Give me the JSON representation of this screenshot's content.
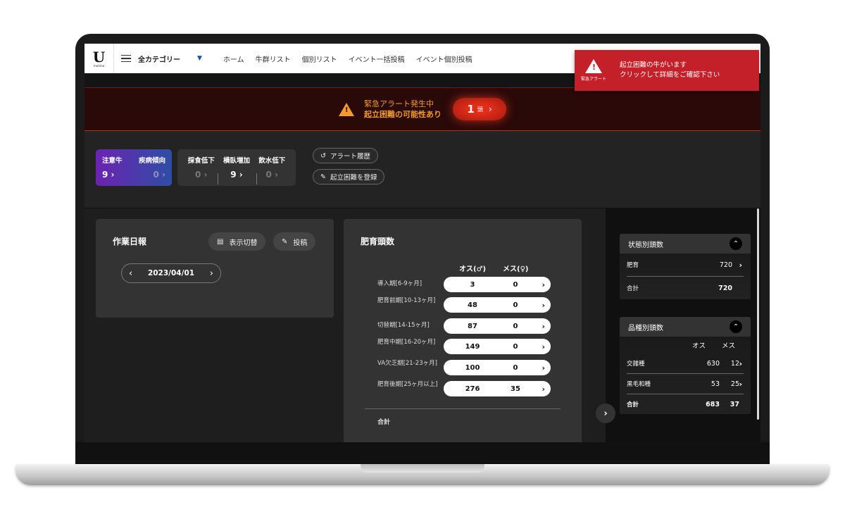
{
  "nav": {
    "logo_mark": "U",
    "logo_sub": "motimo",
    "category_label": "全カテゴリー",
    "category_arrow": "▼",
    "links": [
      "ホーム",
      "牛群リスト",
      "個別リスト",
      "イベント一括投稿",
      "イベント個別投稿"
    ]
  },
  "toast": {
    "tag": "緊急アラート",
    "line1": "起立困難の牛がいます",
    "line2": "クリックして詳細をご確認下さい"
  },
  "banner": {
    "line1": "緊急アラート発生中",
    "line2": "起立困難の可能性あり",
    "count": "1",
    "unit": "頭",
    "chevron": "›"
  },
  "stats": {
    "purple": {
      "labels": [
        "注意牛",
        "疾病傾向"
      ],
      "values": [
        "9 ›",
        "0 ›"
      ]
    },
    "gray": {
      "labels": [
        "採食低下",
        "横臥増加",
        "飲水低下"
      ],
      "values": [
        "0 ›",
        "9 ›",
        "0 ›"
      ]
    },
    "history_label": "アラート履歴",
    "register_label": "起立困難を登録"
  },
  "report": {
    "title": "作業日報",
    "toggle_label": "表示切替",
    "post_label": "投稿",
    "date": "2023/04/01"
  },
  "fatten": {
    "title": "肥育頭数",
    "col_male": "オス(♂)",
    "col_female": "メス(♀)",
    "rows": [
      {
        "label": "導入期[6-9ヶ月]",
        "male": "3",
        "female": "0"
      },
      {
        "label": "肥育前期[10-13ヶ月]",
        "male": "48",
        "female": "0"
      },
      {
        "label": "切替期[14-15ヶ月]",
        "male": "87",
        "female": "0"
      },
      {
        "label": "肥育中期[16-20ヶ月]",
        "male": "149",
        "female": "0"
      },
      {
        "label": "VA欠乏期[21-23ヶ月]",
        "male": "100",
        "female": "0"
      },
      {
        "label": "肥育後期[25ヶ月以上]",
        "male": "276",
        "female": "35"
      }
    ],
    "total_label": "合計"
  },
  "status_card": {
    "title": "状態別頭数",
    "rows": [
      {
        "label": "肥育",
        "value": "720"
      }
    ],
    "total_label": "合計",
    "total_value": "720"
  },
  "breed_card": {
    "title": "品種別頭数",
    "col_male": "オス",
    "col_female": "メス",
    "rows": [
      {
        "label": "交雑種",
        "male": "630",
        "female": "12"
      },
      {
        "label": "黒毛和種",
        "male": "53",
        "female": "25"
      }
    ],
    "total_label": "合計",
    "total_male": "683",
    "total_female": "37"
  },
  "colors": {
    "alert_red": "#c4202a",
    "banner_orange": "#f39a2b",
    "purple_start": "#6b23b0",
    "purple_end": "#2f4ea5"
  }
}
